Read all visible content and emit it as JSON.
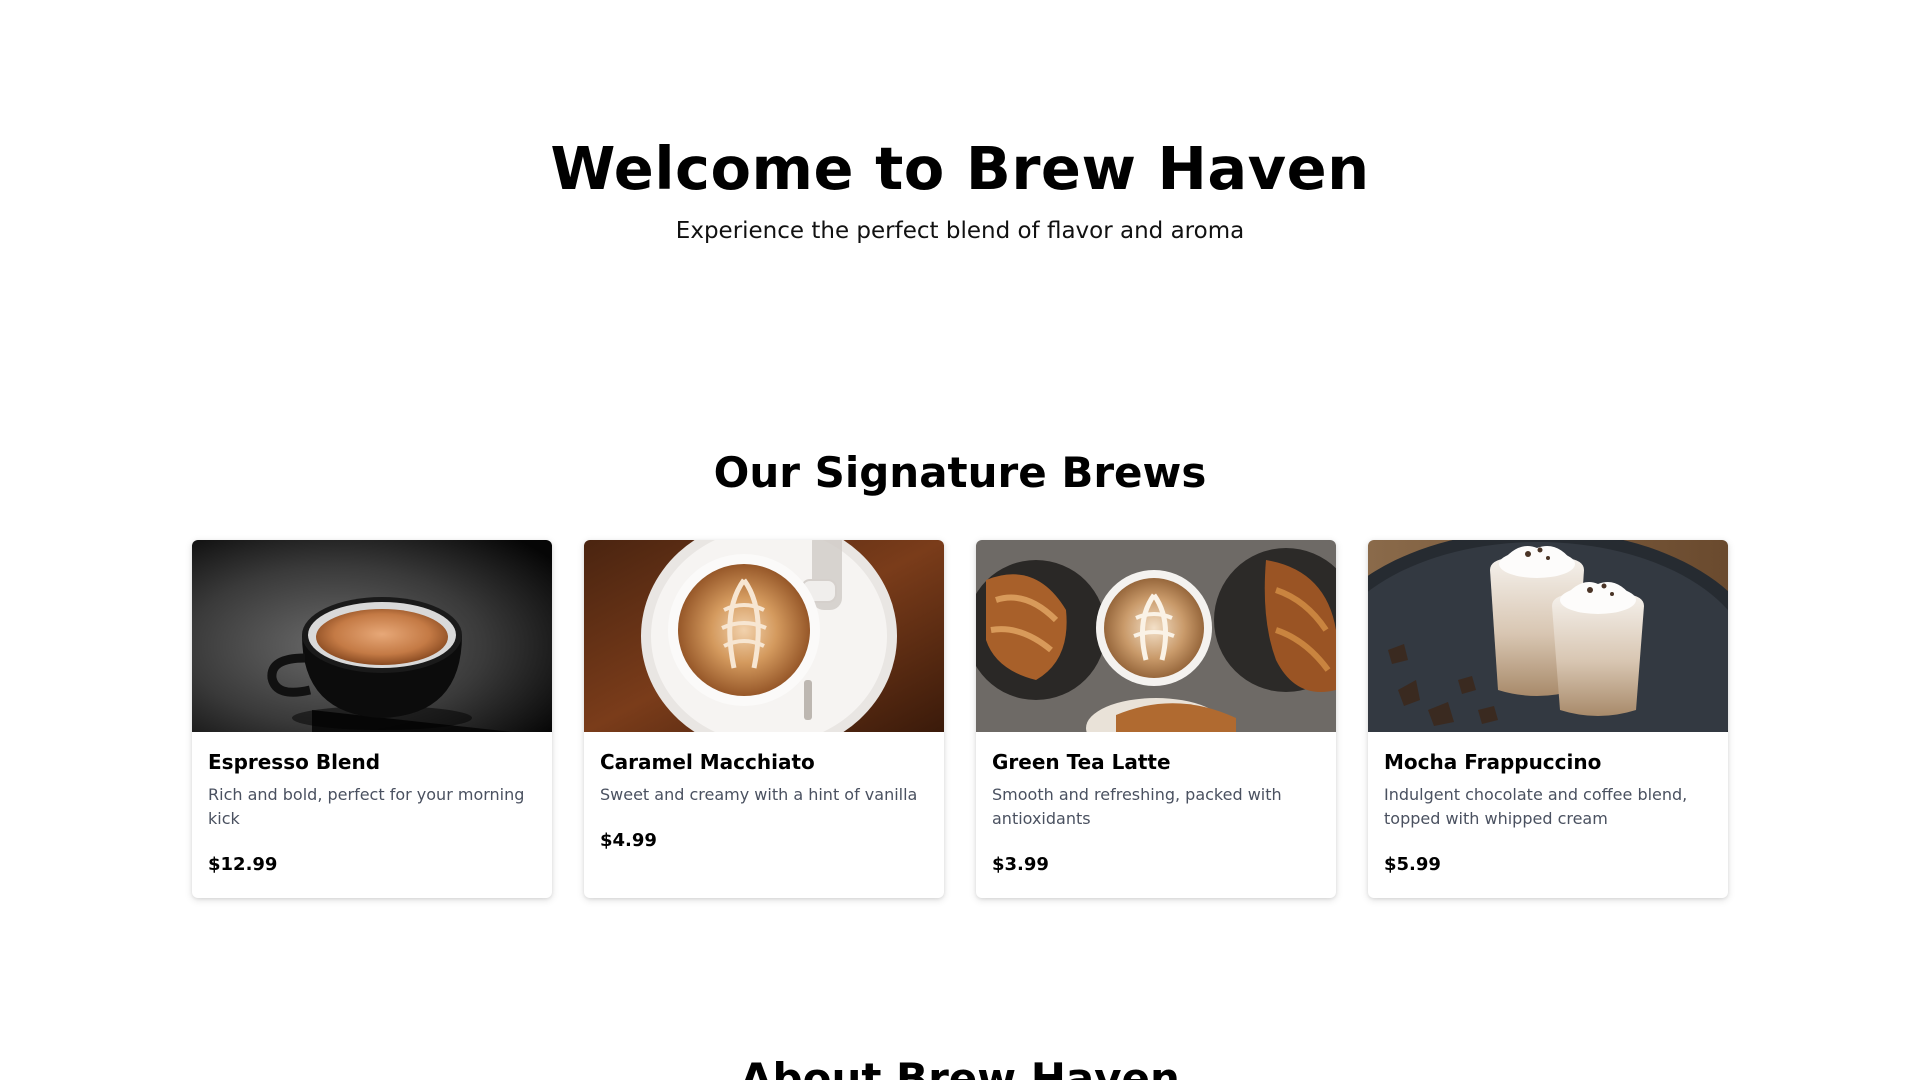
{
  "hero": {
    "title": "Welcome to Brew Haven",
    "subtitle": "Experience the perfect blend of flavor and aroma"
  },
  "products": {
    "section_title": "Our Signature Brews",
    "items": [
      {
        "name": "Espresso Blend",
        "description": "Rich and bold, perfect for your morning kick",
        "price": "$12.99",
        "image": "espresso-cup-photo"
      },
      {
        "name": "Caramel Macchiato",
        "description": "Sweet and creamy with a hint of vanilla",
        "price": "$4.99",
        "image": "latte-art-cup-photo"
      },
      {
        "name": "Green Tea Latte",
        "description": "Smooth and refreshing, packed with antioxidants",
        "price": "$3.99",
        "image": "latte-with-croissants-photo"
      },
      {
        "name": "Mocha Frappuccino",
        "description": "Indulgent chocolate and coffee blend, topped with whipped cream",
        "price": "$5.99",
        "image": "iced-mocha-glasses-photo"
      }
    ]
  },
  "about": {
    "section_title": "About Brew Haven"
  }
}
